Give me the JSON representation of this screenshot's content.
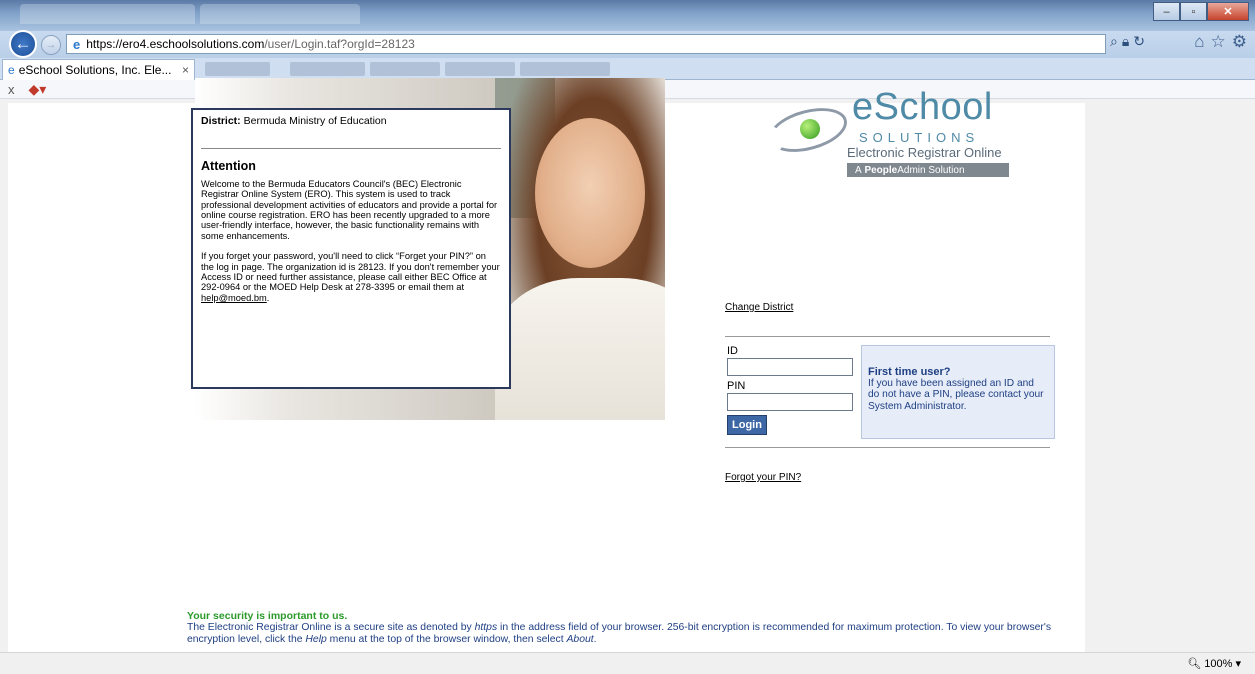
{
  "browser": {
    "url_host": "https://ero4.eschoolsolutions.com",
    "url_path": "/user/Login.taf?orgId=28123",
    "active_tab_title": "eSchool Solutions, Inc. Ele...",
    "tab_close": "×",
    "cmd_close": "x",
    "zoom": "100%",
    "icons": [
      "back-arrow-icon",
      "forward-arrow-icon",
      "search-icon",
      "lock-icon",
      "refresh-icon",
      "home-icon",
      "favorites-star-icon",
      "settings-gear-icon",
      "pdf-icon"
    ]
  },
  "notice": {
    "district_label": "District:",
    "district_value": "Bermuda Ministry of Education",
    "heading": "Attention",
    "paragraph1": "Welcome to the Bermuda Educators Council's (BEC) Electronic Registrar Online System (ERO). This system is used to track professional development activities of educators and provide a portal for online course registration. ERO has been recently upgraded to a more user-friendly interface, however, the basic functionality remains with some enhancements.",
    "paragraph2": "If you forget your password, you'll need to click “Forget your PIN?” on the log in page. The organization id is 28123. If you don't remember your Access ID or need further assistance, please call either BEC Office at 292-0964 or the MOED Help Desk at 278-3395 or email them at",
    "email": "help@moed.bm",
    "after_email": "."
  },
  "logo": {
    "brand": "eSchool",
    "solutions": "SOLUTIONS",
    "tagline": "Electronic Registrar Online",
    "pa_prefix": "A ",
    "pa_bold": "People",
    "pa_rest": "Admin Solution"
  },
  "login": {
    "change_district": "Change District",
    "id_label": "ID",
    "id_value": "",
    "pin_label": "PIN",
    "pin_value": "",
    "login_button": "Login",
    "forgot_pin": "Forgot your PIN?"
  },
  "first_time": {
    "heading": "First time user?",
    "text": "If you have been assigned an ID and do not have a PIN, please contact your System Administrator."
  },
  "security": {
    "heading": "Your security is important to us.",
    "text_a": "The Electronic Registrar Online is a secure site as denoted by",
    "https": "https",
    "text_b": "in the address field of your browser. 256-bit encryption is recommended for maximum protection. To view your browser's encryption level, click the",
    "help": "Help",
    "text_c": "menu at the top of the browser window, then select",
    "about": "About",
    "text_d": "."
  },
  "colors": {
    "link_blue": "#1f3f83",
    "security_green": "#2b9a2b",
    "login_button": "#3e67a6",
    "first_time_bg": "#e6edf8"
  }
}
